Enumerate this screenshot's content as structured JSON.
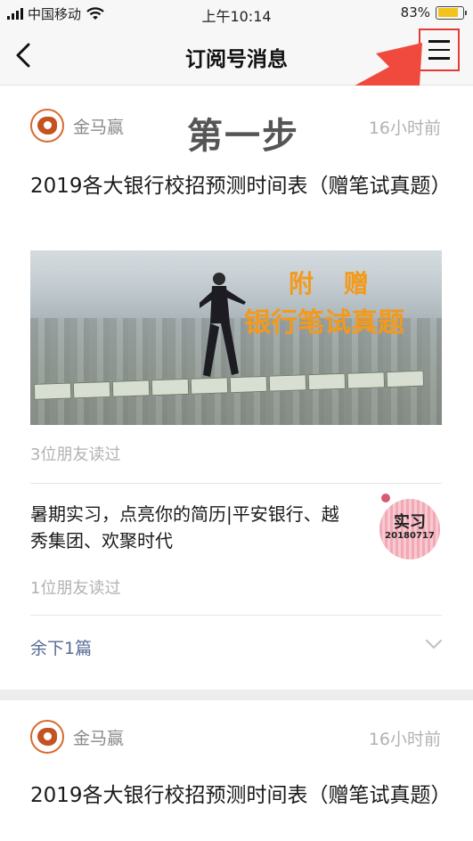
{
  "status_bar": {
    "carrier": "中国移动",
    "time": "上午10:14",
    "battery_percent": "83%",
    "battery_level": 0.83,
    "battery_color": "#f3c41b"
  },
  "nav": {
    "title": "订阅号消息",
    "back_icon": "chevron-left-icon",
    "menu_icon": "hamburger-menu-icon",
    "highlight_color": "#e53935"
  },
  "annotation": {
    "step_text": "第一步",
    "arrow_color": "#f04a3e"
  },
  "feed": [
    {
      "account": "金马赢",
      "time": "16小时前",
      "title": "2019各大银行校招预测时间表（赠笔试真题）",
      "cover_text_line1": "附 赠",
      "cover_text_line2": "银行笔试真题",
      "readers": "3位朋友读过",
      "sub_article": {
        "title": "暑期实习，点亮你的简历|平安银行、越秀集团、欢聚时代",
        "thumb_label": "实习",
        "thumb_date": "20180717",
        "readers": "1位朋友读过"
      },
      "remaining": "余下1篇"
    },
    {
      "account": "金马赢",
      "time": "16小时前",
      "title": "2019各大银行校招预测时间表（赠笔试真题）"
    }
  ],
  "colors": {
    "link_blue": "#576b95",
    "cover_accent": "#f39a1c",
    "page_bg": "#ededed"
  }
}
